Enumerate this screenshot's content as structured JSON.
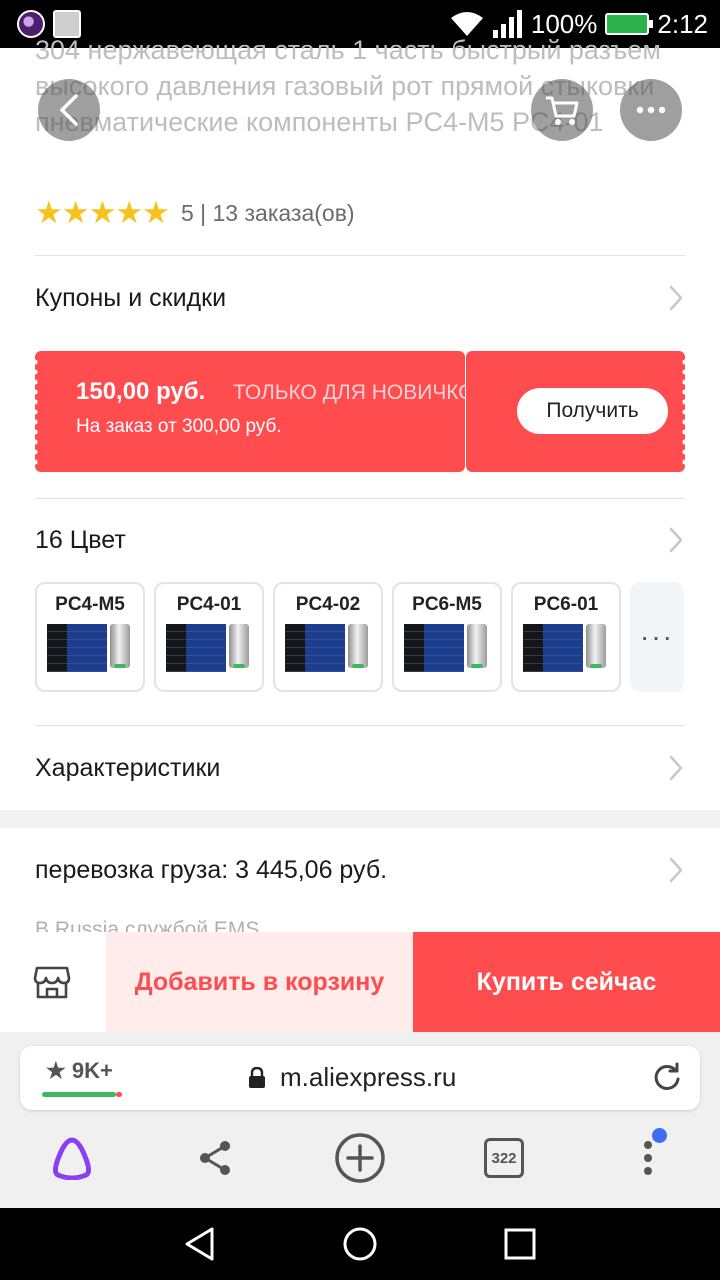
{
  "status_bar": {
    "battery_percent": "100%",
    "time": "2:12"
  },
  "product": {
    "title": "304 нержавеющая сталь 1 часть быстрый разъем высокого давления газовый рот прямой стыковки пневматические компоненты PC4-M5 PC4-01",
    "stars": "★★★★★",
    "rating_text": "5 | 13 заказа(ов)"
  },
  "coupons": {
    "label": "Купоны и скидки"
  },
  "coupon": {
    "amount": "150,00 руб.",
    "tag": "ТОЛЬКО ДЛЯ НОВИЧКОВ",
    "condition": "На заказ от 300,00 руб.",
    "button_label": "Получить"
  },
  "colors_section": {
    "label": "16 Цвет",
    "variants": [
      "PC4-M5",
      "PC4-01",
      "PC4-02",
      "PC6-M5",
      "PC6-01"
    ],
    "more": "···"
  },
  "specs": {
    "label": "Характеристики"
  },
  "shipping": {
    "label": "перевозка груза: 3 445,06 руб.",
    "sub": "В Russia службой EMS"
  },
  "actions": {
    "add_to_cart": "Добавить в корзину",
    "buy_now": "Купить сейчас"
  },
  "browser": {
    "rank": "★ 9K+",
    "url": "m.aliexpress.ru",
    "tab_count": "322"
  },
  "colors": {
    "accent": "#ff4d4f",
    "star": "#f7c21e",
    "alice": "#8a3ff0"
  }
}
